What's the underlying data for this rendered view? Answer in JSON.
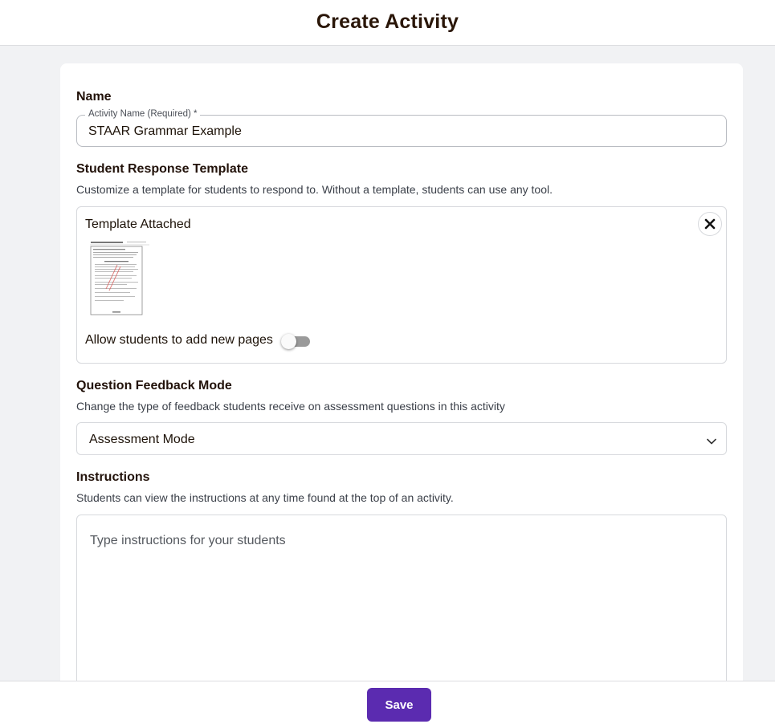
{
  "header": {
    "title": "Create Activity"
  },
  "name_section": {
    "title": "Name",
    "field_label": "Activity Name (Required) *",
    "field_value": "STAAR Grammar Example"
  },
  "template_section": {
    "title": "Student Response Template",
    "description": "Customize a template for students to respond to. Without a template, students can use any tool.",
    "attached_label": "Template Attached",
    "thumbnail_icon": "document-thumbnail",
    "remove_icon": "close-icon",
    "allow_pages_label": "Allow students to add new pages",
    "allow_pages_enabled": false
  },
  "feedback_section": {
    "title": "Question Feedback Mode",
    "description": "Change the type of feedback students receive on assessment questions in this activity",
    "selected_value": "Assessment Mode"
  },
  "instructions_section": {
    "title": "Instructions",
    "description": "Students can view the instructions at any time found at the top of an activity.",
    "placeholder": "Type instructions for your students"
  },
  "footer": {
    "save_label": "Save"
  },
  "colors": {
    "accent": "#5b2bb0",
    "page_background": "#f1f2f4",
    "heading_text": "#22120a"
  }
}
